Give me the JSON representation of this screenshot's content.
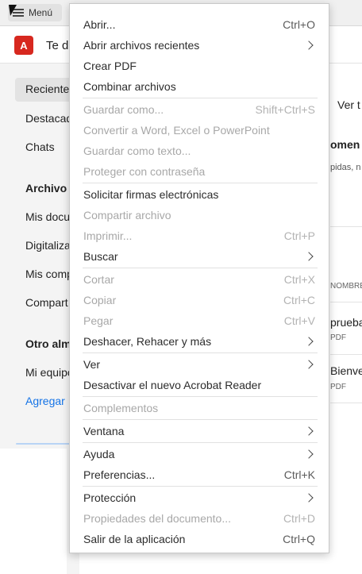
{
  "topbar": {
    "menu_label": "Menú"
  },
  "header": {
    "logo_text": "A",
    "title": "Te d"
  },
  "sidebar": {
    "items": [
      "Reciente",
      "Destacad",
      "Chats"
    ],
    "section1_title": "Archivo",
    "section1_items": [
      "Mis docu",
      "Digitaliza",
      "Mis comp",
      "Compart"
    ],
    "section2_title": "Otro alm",
    "section2_items": [
      "Mi equipo"
    ],
    "add_link": "Agregar"
  },
  "main": {
    "view_link": "Ver t",
    "rec_title": "omen",
    "rec_sub": "pidas, n",
    "col_header": "NOMBRE",
    "files": [
      {
        "name": "prueba",
        "type": "PDF"
      },
      {
        "name": "Bienve",
        "type": "PDF"
      }
    ]
  },
  "menu": {
    "items": [
      {
        "label": "Abrir...",
        "shortcut": "Ctrl+O",
        "disabled": false,
        "submenu": false
      },
      {
        "label": "Abrir archivos recientes",
        "shortcut": "",
        "disabled": false,
        "submenu": true
      },
      {
        "label": "Crear PDF",
        "shortcut": "",
        "disabled": false,
        "submenu": false
      },
      {
        "label": "Combinar archivos",
        "shortcut": "",
        "disabled": false,
        "submenu": false
      },
      {
        "label": "Guardar como...",
        "shortcut": "Shift+Ctrl+S",
        "disabled": true,
        "submenu": false
      },
      {
        "label": "Convertir a Word, Excel o PowerPoint",
        "shortcut": "",
        "disabled": true,
        "submenu": false
      },
      {
        "label": "Guardar como texto...",
        "shortcut": "",
        "disabled": true,
        "submenu": false
      },
      {
        "label": "Proteger con contraseña",
        "shortcut": "",
        "disabled": true,
        "submenu": false
      },
      {
        "label": "Solicitar firmas electrónicas",
        "shortcut": "",
        "disabled": false,
        "submenu": false
      },
      {
        "label": "Compartir archivo",
        "shortcut": "",
        "disabled": true,
        "submenu": false
      },
      {
        "label": "Imprimir...",
        "shortcut": "Ctrl+P",
        "disabled": true,
        "submenu": false
      },
      {
        "label": "Buscar",
        "shortcut": "",
        "disabled": false,
        "submenu": true
      },
      {
        "label": "Cortar",
        "shortcut": "Ctrl+X",
        "disabled": true,
        "submenu": false
      },
      {
        "label": "Copiar",
        "shortcut": "Ctrl+C",
        "disabled": true,
        "submenu": false
      },
      {
        "label": "Pegar",
        "shortcut": "Ctrl+V",
        "disabled": true,
        "submenu": false
      },
      {
        "label": "Deshacer, Rehacer y más",
        "shortcut": "",
        "disabled": false,
        "submenu": true
      },
      {
        "label": "Ver",
        "shortcut": "",
        "disabled": false,
        "submenu": true
      },
      {
        "label": "Desactivar el nuevo Acrobat Reader",
        "shortcut": "",
        "disabled": false,
        "submenu": false
      },
      {
        "label": "Complementos",
        "shortcut": "",
        "disabled": true,
        "submenu": false
      },
      {
        "label": "Ventana",
        "shortcut": "",
        "disabled": false,
        "submenu": true
      },
      {
        "label": "Ayuda",
        "shortcut": "",
        "disabled": false,
        "submenu": true
      },
      {
        "label": "Preferencias...",
        "shortcut": "Ctrl+K",
        "disabled": false,
        "submenu": false
      },
      {
        "label": "Protección",
        "shortcut": "",
        "disabled": false,
        "submenu": true
      },
      {
        "label": "Propiedades del documento...",
        "shortcut": "Ctrl+D",
        "disabled": true,
        "submenu": false
      },
      {
        "label": "Salir de la aplicación",
        "shortcut": "Ctrl+Q",
        "disabled": false,
        "submenu": false
      }
    ]
  }
}
